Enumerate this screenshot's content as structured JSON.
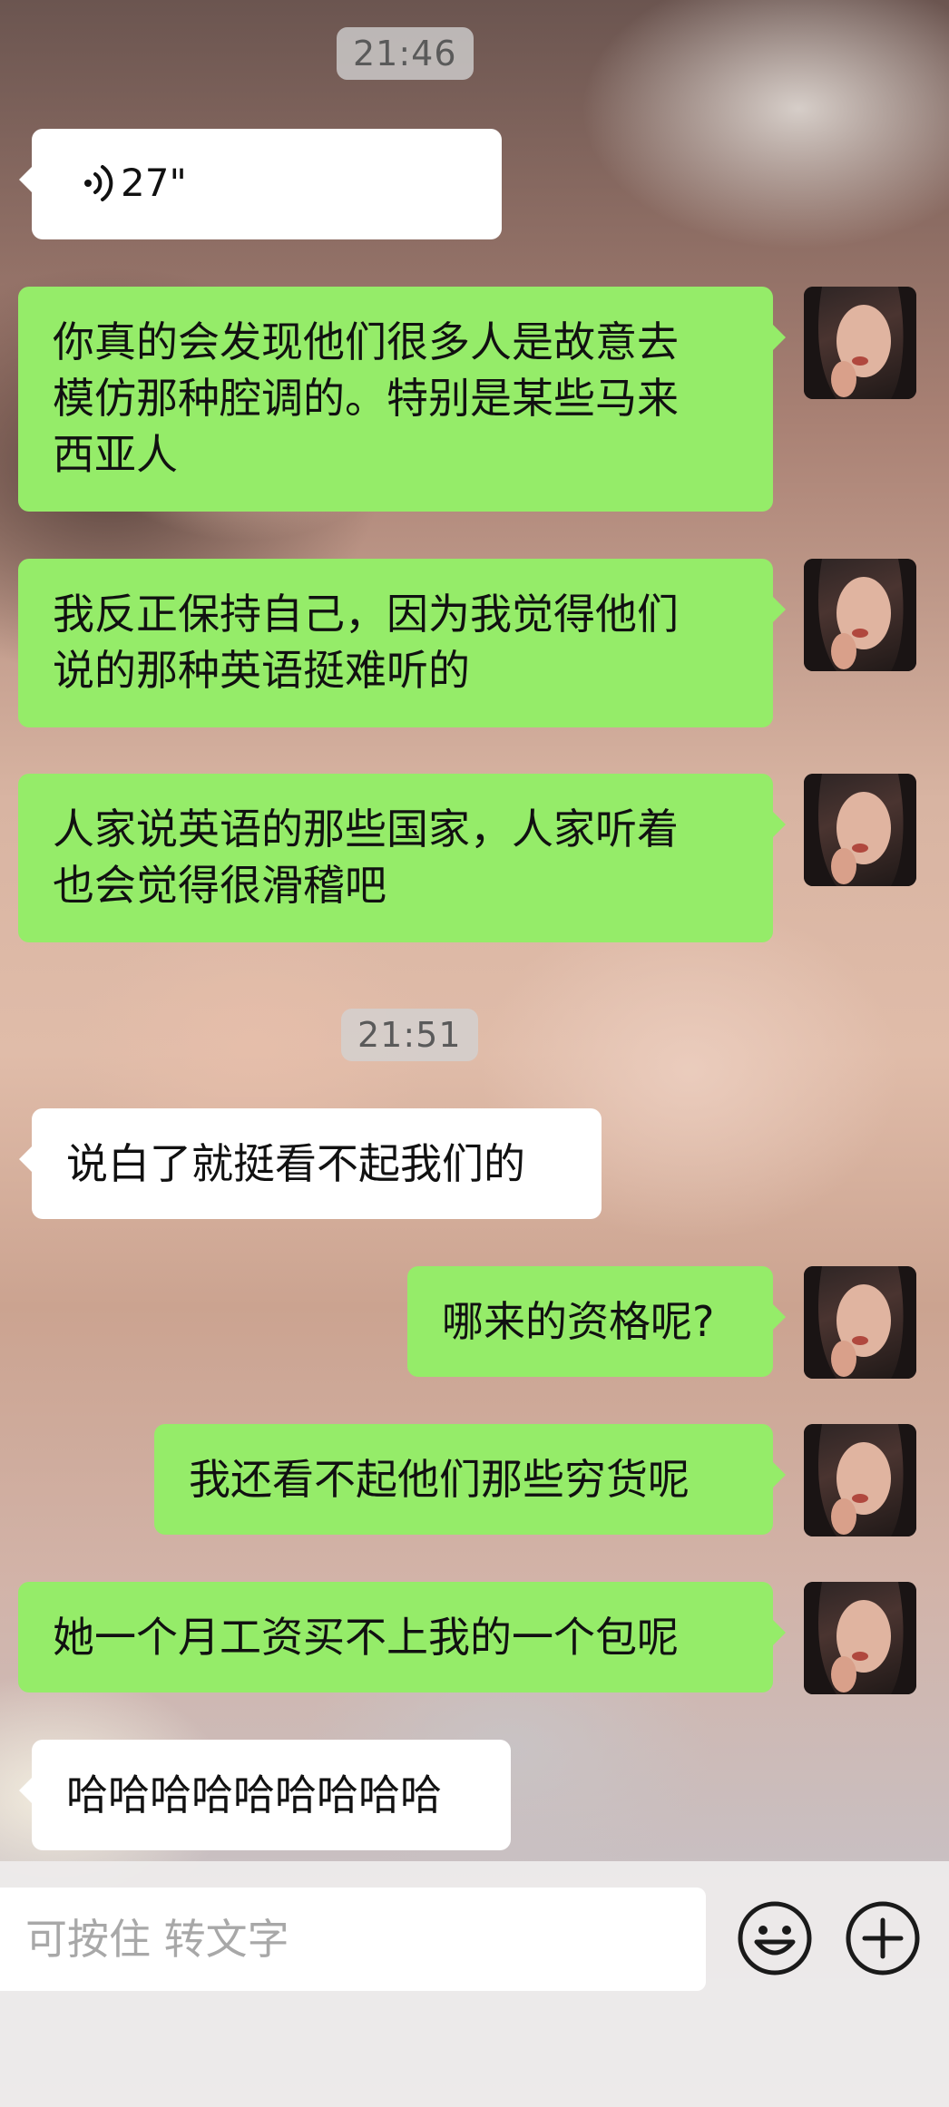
{
  "timestamps": [
    "21:46",
    "21:51"
  ],
  "voice_message": {
    "duration": "27\""
  },
  "messages": [
    {
      "side": "out",
      "lines": [
        "你真的会发现他们很多人是故意去",
        "模仿那种腔调的。特别是某些马来",
        "西亚人"
      ]
    },
    {
      "side": "out",
      "lines": [
        "我反正保持自己，因为我觉得他们",
        "说的那种英语挺难听的"
      ]
    },
    {
      "side": "out",
      "lines": [
        "人家说英语的那些国家，人家听着",
        "也会觉得很滑稽吧"
      ]
    },
    {
      "side": "in",
      "lines": [
        "说白了就挺看不起我们的"
      ]
    },
    {
      "side": "out",
      "lines": [
        "哪来的资格呢?"
      ]
    },
    {
      "side": "out",
      "lines": [
        "我还看不起他们那些穷货呢"
      ]
    },
    {
      "side": "out",
      "lines": [
        "她一个月工资买不上我的一个包呢"
      ]
    },
    {
      "side": "in",
      "lines": [
        "哈哈哈哈哈哈哈哈哈"
      ]
    }
  ],
  "input_bar": {
    "placeholder": "可按住 转文字",
    "emoji_icon": "emoji-icon",
    "add_icon": "plus-circle-icon"
  },
  "colors": {
    "outgoing_bubble": "#95ec69",
    "incoming_bubble": "#ffffff",
    "timestamp_bg": "#d2d2d2"
  }
}
